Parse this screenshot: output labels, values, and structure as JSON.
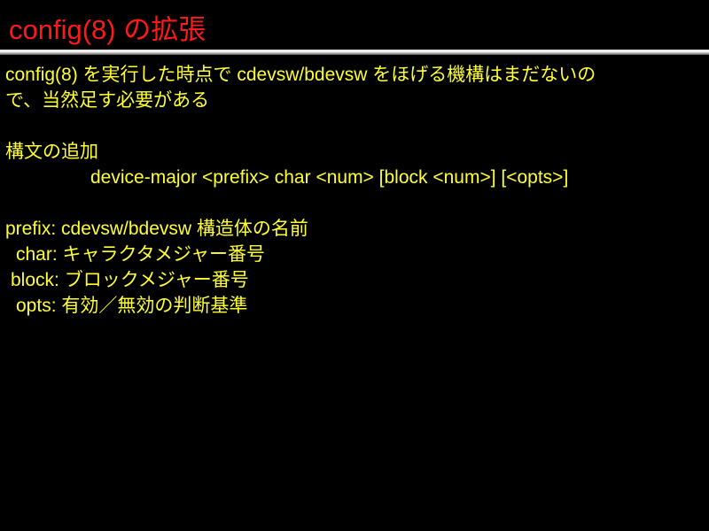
{
  "slide": {
    "title": "config(8) の拡張",
    "intro": [
      "config(8) を実行した時点で cdevsw/bdevsw をほげる機構はまだないの",
      "で、当然足す必要がある"
    ],
    "syntax_heading": "構文の追加",
    "syntax_line": "device-major <prefix> char <num> [block <num>] [<opts>]",
    "fields": {
      "prefix": "prefix: cdevsw/bdevsw 構造体の名前",
      "char": "char: キャラクタメジャー番号",
      "block": "block: ブロックメジャー番号",
      "opts": "opts: 有効／無効の判断基準"
    }
  },
  "colors": {
    "background": "#000000",
    "title": "#ff1a1a",
    "body": "#ffff33"
  }
}
